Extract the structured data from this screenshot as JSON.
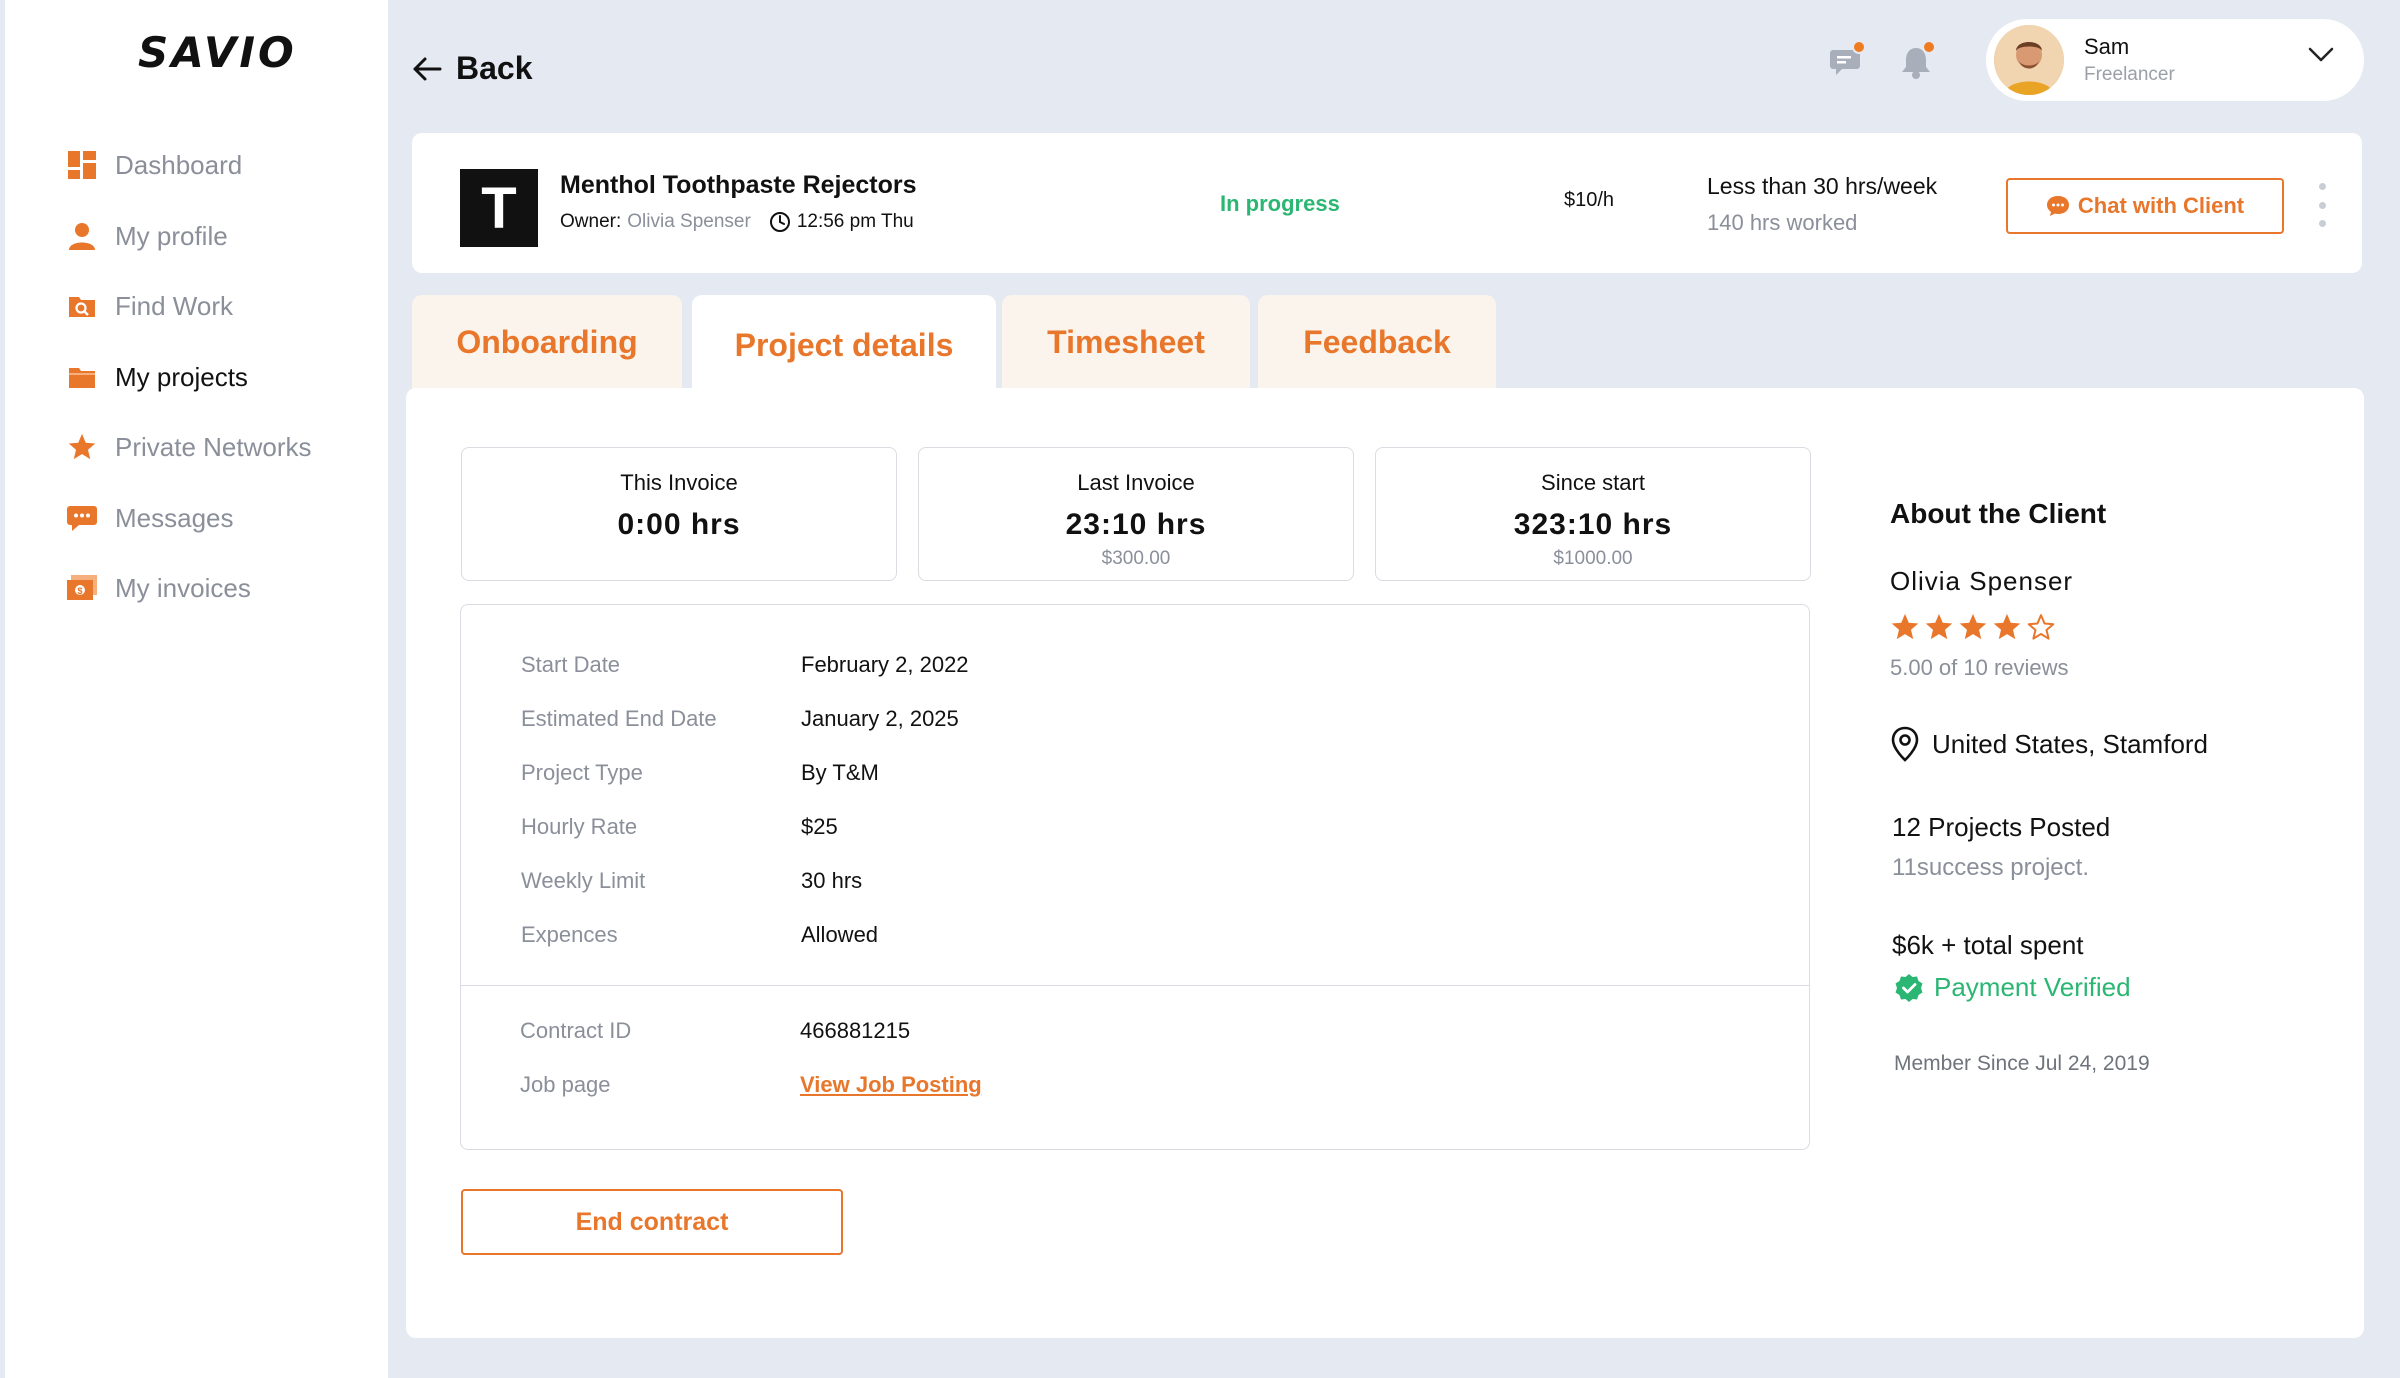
{
  "app": {
    "logo": "SAVIO",
    "accent_color": "#E8762B",
    "success_color": "#2BB673"
  },
  "sidebar": {
    "items": [
      {
        "label": "Dashboard",
        "icon": "dashboard-icon"
      },
      {
        "label": "My profile",
        "icon": "user-icon"
      },
      {
        "label": "Find Work",
        "icon": "search-folder-icon"
      },
      {
        "label": "My projects",
        "icon": "folder-icon",
        "active": true
      },
      {
        "label": "Private Networks",
        "icon": "star-icon"
      },
      {
        "label": "Messages",
        "icon": "chat-icon"
      },
      {
        "label": "My invoices",
        "icon": "invoice-icon"
      }
    ]
  },
  "header": {
    "back_label": "Back",
    "user": {
      "name": "Sam",
      "role": "Freelancer"
    }
  },
  "project": {
    "logo_letter": "T",
    "title": "Menthol Toothpaste Rejectors",
    "owner_label": "Owner:",
    "owner_name": "Olivia Spenser",
    "time": "12:56 pm Thu",
    "status": "In progress",
    "rate": "$10/h",
    "hours_limit": "Less than 30 hrs/week",
    "hours_worked": "140 hrs worked",
    "chat_button": "Chat with Client"
  },
  "tabs": [
    {
      "label": "Onboarding"
    },
    {
      "label": "Project details",
      "active": true
    },
    {
      "label": "Timesheet"
    },
    {
      "label": "Feedback"
    }
  ],
  "stats": [
    {
      "label": "This Invoice",
      "value": "0:00 hrs",
      "sub": ""
    },
    {
      "label": "Last Invoice",
      "value": "23:10 hrs",
      "sub": "$300.00"
    },
    {
      "label": "Since start",
      "value": "323:10 hrs",
      "sub": "$1000.00"
    }
  ],
  "details": {
    "start_date": {
      "key": "Start Date",
      "value": "February 2, 2022"
    },
    "end_date": {
      "key": "Estimated End Date",
      "value": "January 2, 2025"
    },
    "project_type": {
      "key": "Project Type",
      "value": "By T&M"
    },
    "hourly_rate": {
      "key": "Hourly Rate",
      "value": "$25"
    },
    "weekly_limit": {
      "key": "Weekly Limit",
      "value": "30 hrs"
    },
    "expenses": {
      "key": "Expences",
      "value": "Allowed"
    },
    "contract_id": {
      "key": "Contract ID",
      "value": "466881215"
    },
    "job_page": {
      "key": "Job page",
      "value": "View Job Posting"
    }
  },
  "end_contract_button": "End contract",
  "client": {
    "section_title": "About the Client",
    "name": "Olivia Spenser",
    "rating": 4,
    "rating_max": 5,
    "reviews": "5.00 of  10 reviews",
    "location": "United States, Stamford",
    "projects_posted": "12 Projects Posted",
    "success": "11success project.",
    "spent": "$6k + total spent",
    "payment": "Payment Verified",
    "member_since": "Member Since Jul 24, 2019"
  }
}
